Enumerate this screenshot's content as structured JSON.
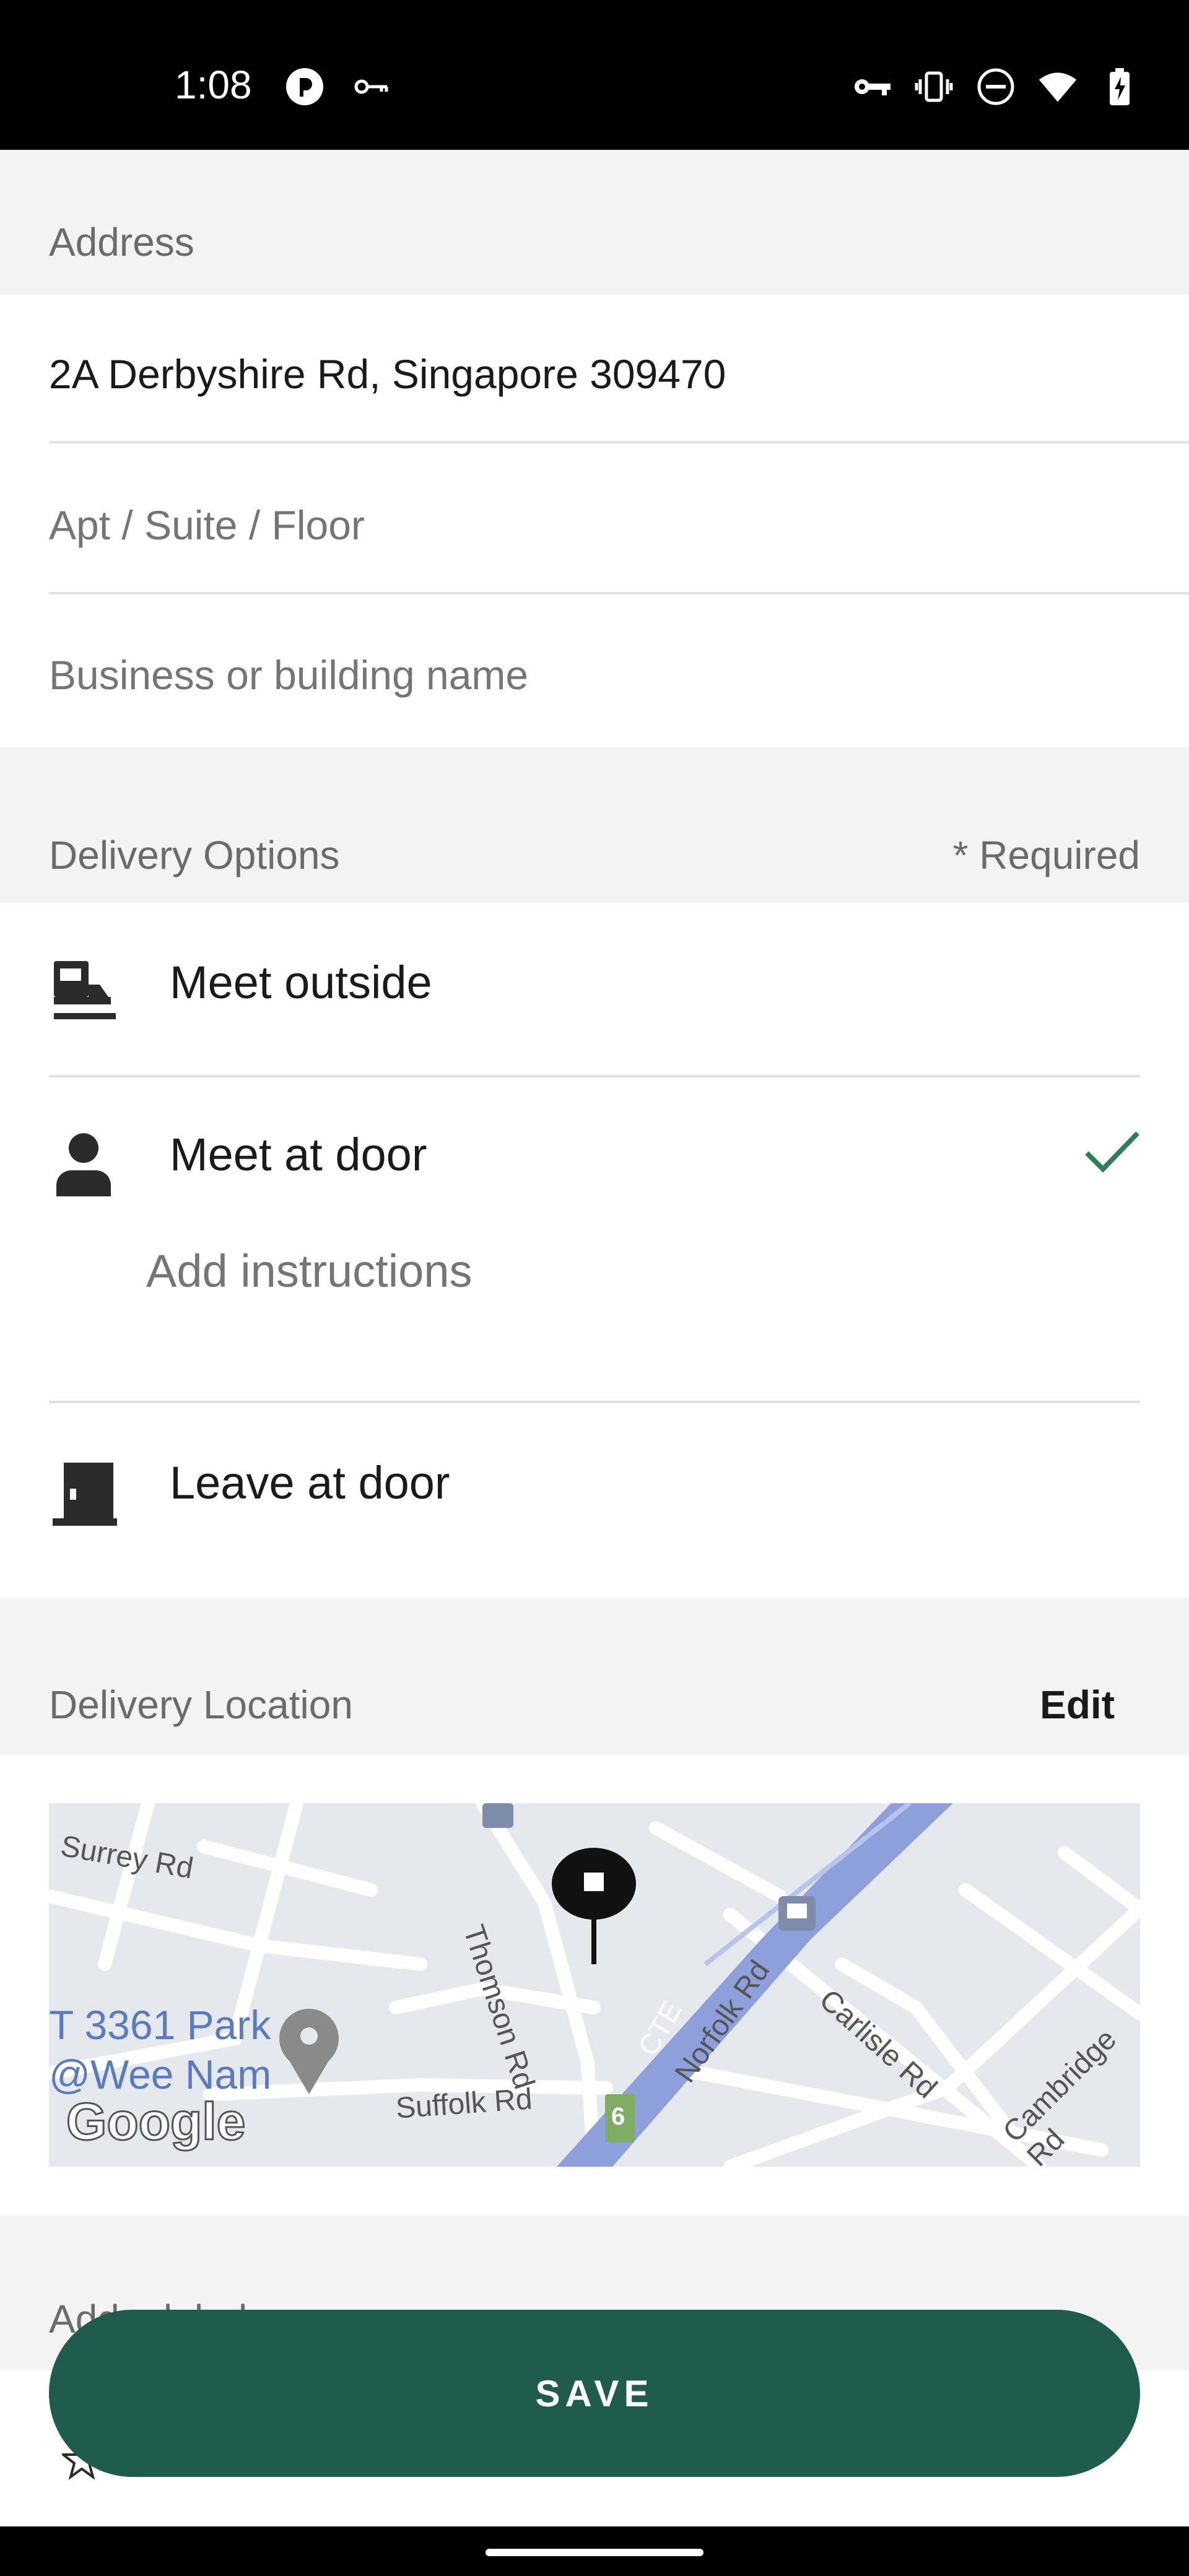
{
  "status_bar": {
    "time": "1:08",
    "left_icons": [
      "privacy-icon",
      "key-icon"
    ],
    "right_icons": [
      "vpn-key-icon",
      "vibrate-icon",
      "do-not-disturb-icon",
      "wifi-icon",
      "battery-charging-icon"
    ]
  },
  "address": {
    "section_title": "Address",
    "street_value": "2A Derbyshire Rd, Singapore 309470",
    "apt_placeholder": "Apt / Suite / Floor",
    "business_placeholder": "Business or building name"
  },
  "delivery_options": {
    "section_title": "Delivery Options",
    "required_label": "* Required",
    "options": [
      {
        "label": "Meet outside",
        "icon": "car-curbside-icon",
        "selected": false
      },
      {
        "label": "Meet at door",
        "icon": "person-icon",
        "selected": true
      },
      {
        "label": "Leave at door",
        "icon": "door-icon",
        "selected": false
      }
    ],
    "instructions_placeholder": "Add instructions",
    "selected_color": "#2e7d5b"
  },
  "delivery_location": {
    "section_title": "Delivery Location",
    "edit_label": "Edit",
    "map_labels": {
      "surrey": "Surrey Rd",
      "thomson": "Thomson Rd",
      "cte": "CTE",
      "norfolk": "Norfolk Rd",
      "carlisle": "Carlisle Rd",
      "cambridge": "Cambridge Rd",
      "suffolk": "Suffolk Rd",
      "park_line1": "T 3361 Park",
      "park_line2": "@Wee Nam",
      "route_badge": "6",
      "google_logo": "Google"
    }
  },
  "partial_section_title": "Add a label",
  "save_button": "SAVE",
  "colors": {
    "brand_green": "#1f5c4e",
    "expressway": "#8da0dc",
    "map_bg": "#e5e8ec"
  }
}
